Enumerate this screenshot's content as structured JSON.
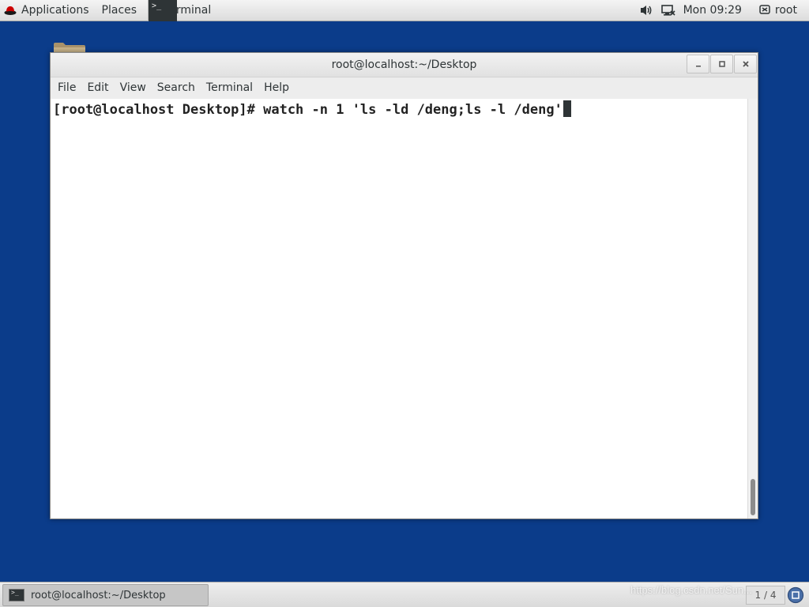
{
  "top_panel": {
    "applications_label": "Applications",
    "places_label": "Places",
    "active_task_label": "Terminal",
    "clock": "Mon 09:29",
    "user_label": "root",
    "icons": {
      "applications": "redhat-icon",
      "volume": "volume-icon",
      "network": "network-icon",
      "user": "user-icon"
    }
  },
  "window": {
    "title": "root@localhost:~/Desktop",
    "controls": [
      "minimize-icon",
      "maximize-icon",
      "close-icon"
    ],
    "menu": [
      "File",
      "Edit",
      "View",
      "Search",
      "Terminal",
      "Help"
    ]
  },
  "terminal": {
    "prompt": "[root@localhost Desktop]#",
    "command": " watch -n 1 'ls -ld /deng;ls -l /deng'"
  },
  "bottom_panel": {
    "task_label": "root@localhost:~/Desktop",
    "workspace_label": "1 / 4"
  },
  "watermark": "https://blog.csdn.net/Sun...",
  "colors": {
    "desktop_background": "#0b3c8a",
    "panel": "#e6e6e6",
    "terminal_background": "#ffffff",
    "terminal_text": "#222222"
  }
}
